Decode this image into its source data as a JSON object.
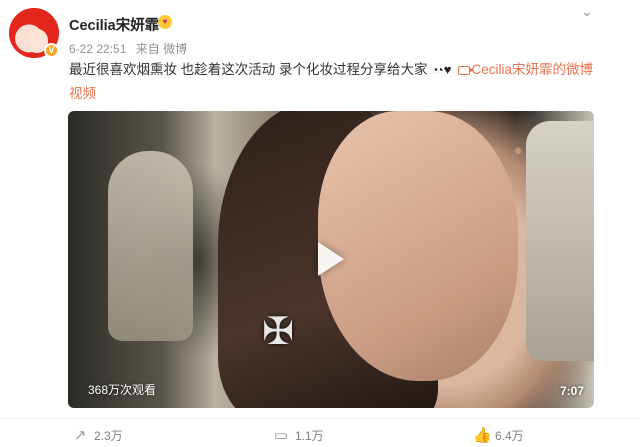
{
  "post": {
    "username": "Cecilia宋妍霏",
    "time": "6-22 22:51",
    "source": "来自 微博",
    "text": "最近很喜欢烟熏妆 也趁着这次活动 录个化妆过程分享给大家",
    "link_text": "Cecilia宋妍霏的微博视频"
  },
  "icons": {
    "verified": "verified-v-icon",
    "emoji": "heart-eyes-emoji-icon",
    "more": "chevron-down-icon",
    "play": "play-icon",
    "forward": "forward-icon",
    "comment": "comment-icon",
    "like": "like-icon"
  },
  "video": {
    "views": "368万次观看",
    "duration": "7:07"
  },
  "actions": {
    "forward_count": "2.3万",
    "comment_count": "1.1万",
    "like_count": "6.4万"
  },
  "colors": {
    "link": "#eb7350",
    "badge": "#f7a623"
  }
}
